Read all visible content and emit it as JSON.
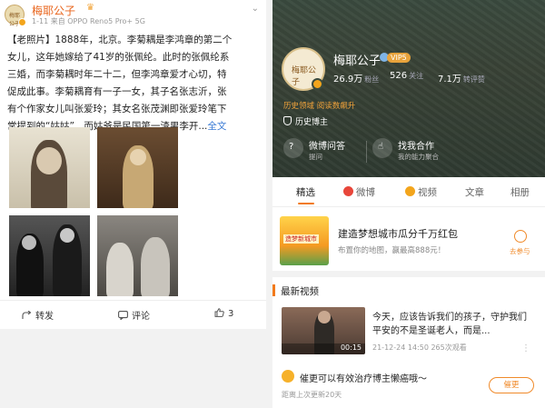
{
  "post": {
    "avatar_text": "梅耶公子",
    "username": "梅耶公子",
    "meta": "1-11 来自 OPPO Reno5 Pro+ 5G",
    "more_icon": "more-icon",
    "lines": [
      "【老照片】1888年，北京。李菊耦是李鸿章的第二个",
      "女儿，这年她嫁给了41岁的张佩纶。此时的张佩纶系",
      "三婚，而李菊耦时年二十二，但李鸿章爱才心切，特",
      "促成此事。李菊耦育有一子一女，其子名张志沂，张",
      "有个作家女儿叫张爱玲；其女名张茂渊即张爱玲笔下",
      "常提到的“姑姑”，而姑爷是民国第一渣男李开..."
    ],
    "full_text_link": "全文",
    "actions": {
      "repost": "转发",
      "comment": "评论",
      "like_count": "3"
    }
  },
  "profile": {
    "name": "梅耶公子",
    "avatar_text": "梅耶公子",
    "vip_badge": "VIP5",
    "stats": [
      {
        "value": "26.9万",
        "label": "粉丝"
      },
      {
        "value": "526",
        "label": "关注"
      },
      {
        "value": "7.1万",
        "label": "转评赞"
      }
    ],
    "tagline": "历史领域 阅读数飙升",
    "certification": "历史博主",
    "services": [
      {
        "title": "微博问答",
        "sub": "提问",
        "icon": "qa-icon"
      },
      {
        "title": "找我合作",
        "sub": "我的能力聚合",
        "icon": "cooperate-icon"
      }
    ],
    "tabs": [
      "精选",
      "微博",
      "视频",
      "文章",
      "相册"
    ],
    "ad": {
      "image_text": "造梦新城市",
      "title": "建造梦想城市瓜分千万红包",
      "desc": "布置你的地图，赢最高888元！",
      "button": "去参与"
    },
    "section_title": "最新视频",
    "video": {
      "title": "今天，应该告诉我们的孩子，守护我们平安的不是圣诞老人，而是...",
      "duration": "00:15",
      "meta": "21-12-24 14:50 265次观看"
    },
    "urge": {
      "text": "催更可以有效治疗博主懒癌哦～",
      "sub": "距离上次更新20天",
      "button": "催更"
    }
  },
  "colors": {
    "accent_orange": "#f27a1a",
    "username_orange": "#e8631a",
    "link_blue": "#3a7bd5",
    "banner_green": "#3a4a3e"
  }
}
